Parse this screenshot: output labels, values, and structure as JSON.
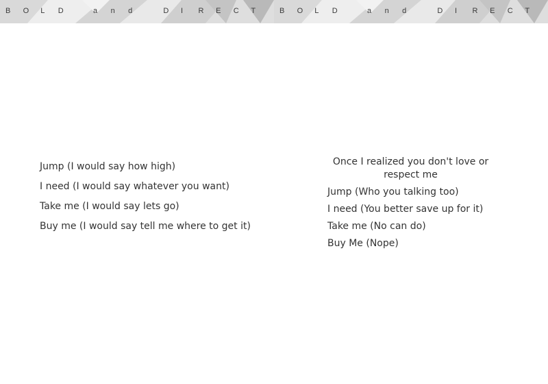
{
  "banner": {
    "title": "BOLD and DIRECT"
  },
  "left_column": {
    "lines": [
      "Jump (I would say how high)",
      "I need (I would say whatever you want)",
      "Take me (I would say lets go)",
      "Buy me (I would say tell me where to get it)"
    ]
  },
  "right_column": {
    "intro": "Once I  realized you don't love or respect me",
    "lines": [
      "Jump (Who you talking too)",
      "I need (You better  save up for it)",
      "Take me (No can do)",
      "Buy Me (Nope)"
    ]
  }
}
